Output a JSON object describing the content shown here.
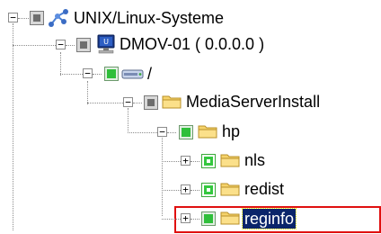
{
  "tree": {
    "nodes": [
      {
        "id": "root",
        "label": "UNIX/Linux-Systeme",
        "icon": "network-icon",
        "state": "gray",
        "expanded": true
      },
      {
        "id": "host",
        "label": "DMOV-01 ( 0.0.0.0 )",
        "icon": "computer-icon",
        "state": "gray",
        "expanded": true
      },
      {
        "id": "drive",
        "label": "/",
        "icon": "drive-icon",
        "state": "green",
        "expanded": true
      },
      {
        "id": "msi",
        "label": "MediaServerInstall",
        "icon": "folder-icon",
        "state": "gray",
        "expanded": true
      },
      {
        "id": "hp",
        "label": "hp",
        "icon": "folder-icon",
        "state": "green",
        "expanded": true
      },
      {
        "id": "nls",
        "label": "nls",
        "icon": "folder-icon",
        "state": "green-hollow",
        "expanded": false
      },
      {
        "id": "redist",
        "label": "redist",
        "icon": "folder-icon",
        "state": "green-hollow",
        "expanded": false
      },
      {
        "id": "reginfo",
        "label": "reginfo",
        "icon": "folder-icon",
        "state": "green",
        "expanded": false,
        "selected": true
      }
    ],
    "expander_expanded": "−",
    "expander_collapsed": "+"
  },
  "colors": {
    "selection_bg": "#0a246a",
    "highlight_frame": "#e01010",
    "checked_green": "#2fbf3a",
    "partial_gray": "#6e6e6e"
  }
}
